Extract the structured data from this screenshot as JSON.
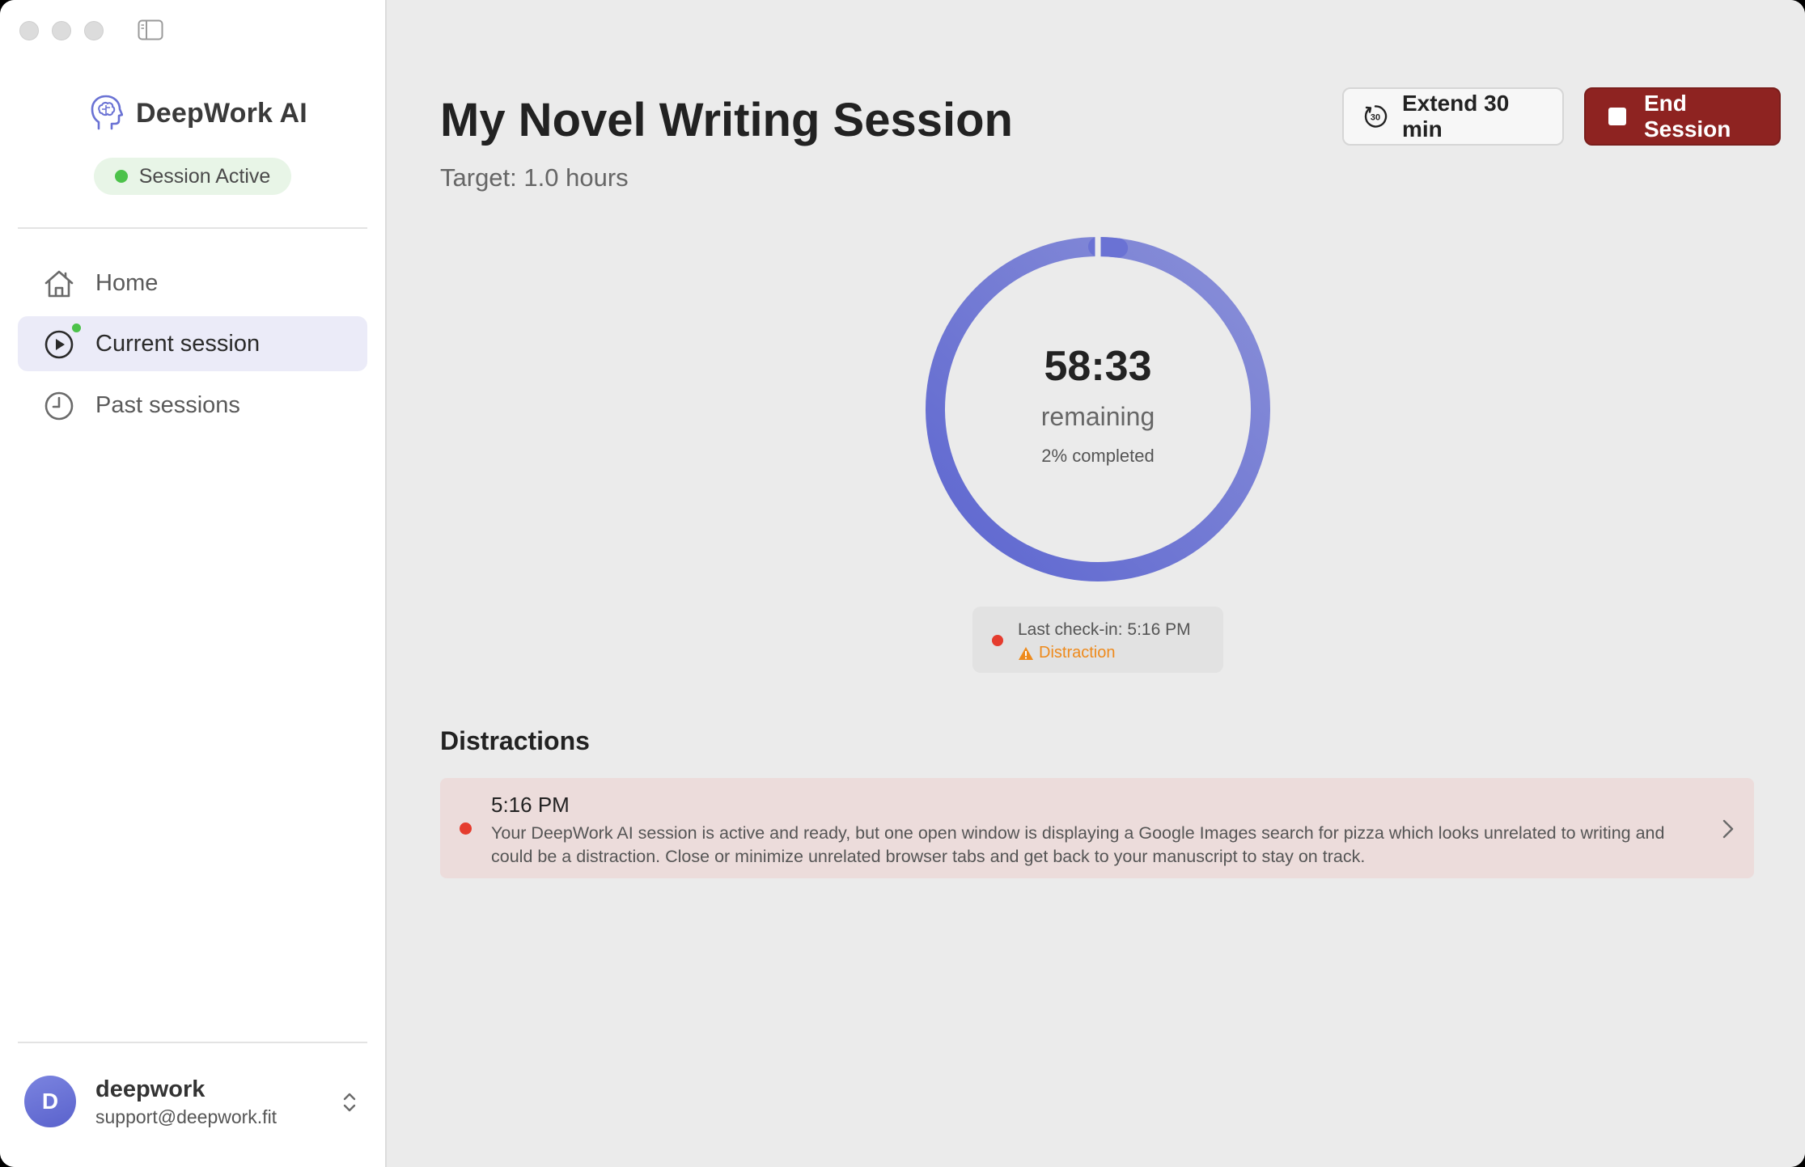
{
  "sidebar": {
    "brand": "DeepWork AI",
    "status": "Session Active",
    "nav": [
      {
        "label": "Home",
        "icon": "home-icon"
      },
      {
        "label": "Current session",
        "icon": "play-circle-icon"
      },
      {
        "label": "Past sessions",
        "icon": "clock-icon"
      }
    ],
    "user": {
      "initial": "D",
      "name": "deepwork",
      "email": "support@deepwork.fit"
    }
  },
  "header": {
    "title": "My Novel Writing Session",
    "target": "Target: 1.0 hours",
    "extend_label": "Extend 30 min",
    "extend_icon_text": "30",
    "end_label": "End Session"
  },
  "timer": {
    "time": "58:33",
    "remaining_label": "remaining",
    "completed_text": "2% completed",
    "progress_percent": 2
  },
  "checkin": {
    "time_text": "Last check-in: 5:16 PM",
    "status": "Distraction"
  },
  "distractions": {
    "title": "Distractions",
    "items": [
      {
        "time": "5:16 PM",
        "message": "Your DeepWork AI session is active and ready, but one open window is displaying a Google Images search for pizza which looks unrelated to writing and could be a distraction. Close or minimize unrelated browser tabs and get back to your manuscript to stay on track."
      }
    ]
  },
  "colors": {
    "accent": "#6a72d4",
    "danger": "#8e2321",
    "active_green": "#4cc24a",
    "warning": "#ee8a1c"
  }
}
